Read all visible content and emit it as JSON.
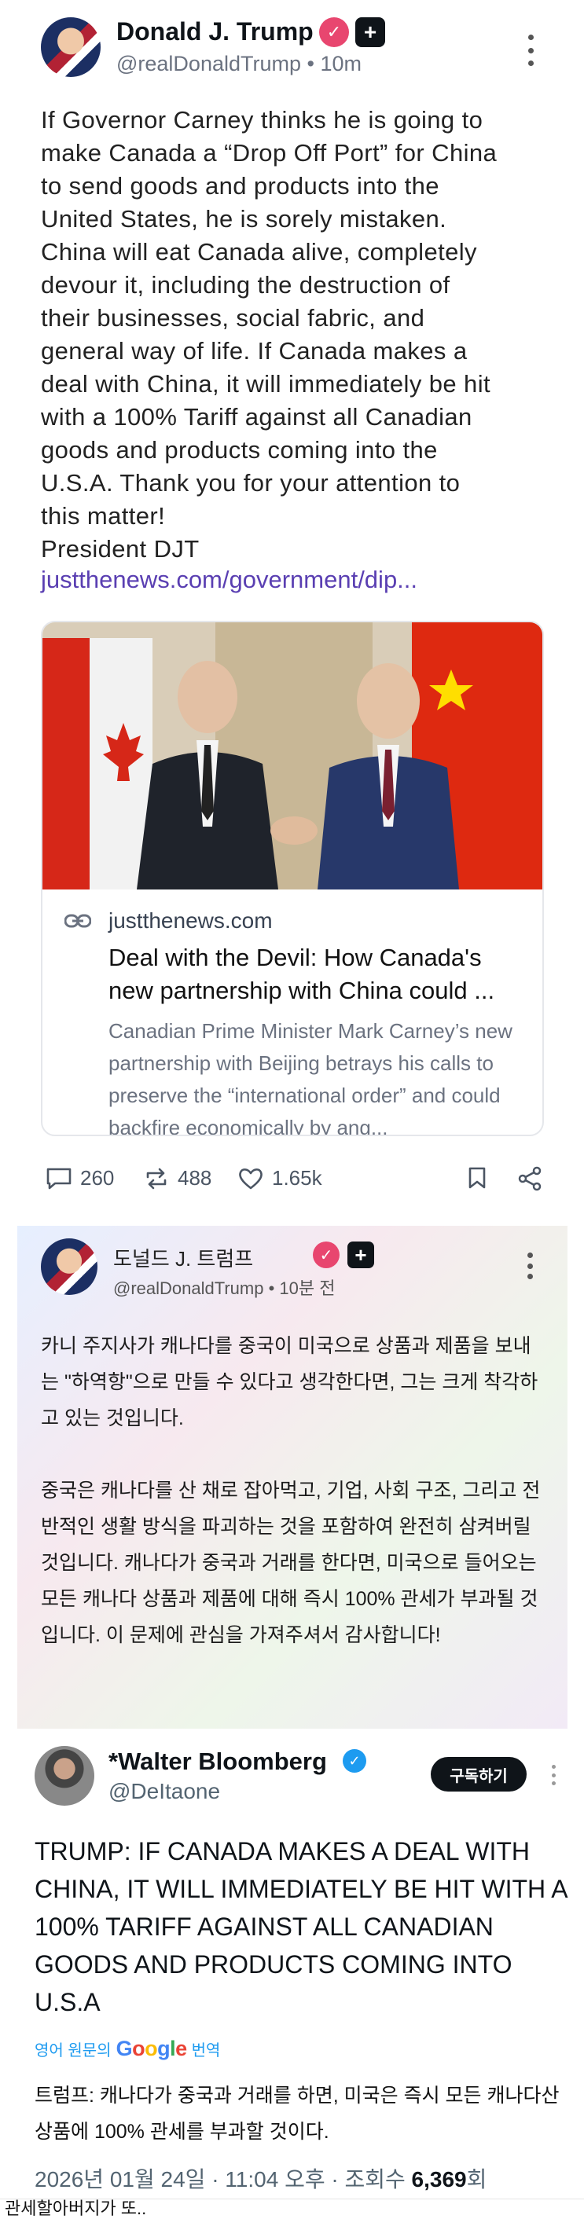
{
  "truth_post": {
    "author_name": "Donald J. Trump",
    "handle_time": "@realDonaldTrump • 10m",
    "body_lines": [
      "If Governor Carney thinks he is going to",
      "make Canada a “Drop Off Port” for China",
      "to send goods and products into the",
      "United States, he is sorely mistaken.",
      "China will eat Canada alive, completely",
      "devour it, including the destruction of",
      "their businesses, social fabric, and",
      "general way of life. If Canada makes a",
      "deal with China, it will immediately be hit",
      "with a 100% Tariff against all Canadian",
      "goods and products coming into the",
      "U.S.A. Thank you for your attention to",
      "this matter!",
      "President DJT"
    ],
    "link_text": "justthenews.com/government/dip...",
    "card": {
      "source": "justthenews.com",
      "title": "Deal with the Devil: How Canada's new partnership with China could ...",
      "description": "Canadian Prime Minister Mark Carney’s new partnership with Beijing betrays his calls to preserve the “international order” and could backfire economically by ang..."
    },
    "actions": {
      "replies": "260",
      "retruths": "488",
      "likes": "1.65k"
    }
  },
  "korean_card": {
    "author_name": "도널드 J. 트럼프",
    "handle_time": "@realDonaldTrump • 10분 전",
    "paragraphs": [
      "카니 주지사가 캐나다를 중국이 미국으로 상품과 제품을 보내는 \"하역항\"으로 만들 수 있다고 생각한다면, 그는 크게 착각하고 있는 것입니다.",
      "중국은 캐나다를 산 채로 잡아먹고, 기업, 사회 구조, 그리고 전반적인 생활 방식을 파괴하는 것을 포함하여 완전히 삼켜버릴 것입니다. 캐나다가 중국과 거래를 한다면, 미국으로 들어오는 모든 캐나다 상품과 제품에 대해 즉시 100% 관세가 부과될 것입니다. 이 문제에 관심을 가져주셔서 감사합니다!"
    ]
  },
  "x_post": {
    "author_name": "*Walter Bloomberg",
    "handle": "@DeItaone",
    "subscribe_label": "구독하기",
    "body": "TRUMP: IF CANADA MAKES A DEAL WITH CHINA, IT WILL IMMEDIATELY BE HIT WITH A 100% TARIFF AGAINST ALL CANADIAN GOODS AND PRODUCTS COMING INTO U.S.A",
    "translate_prefix": "영어 원문의",
    "translate_brand": "Google",
    "translate_suffix": "번역",
    "translated_body": "트럼프: 캐나다가 중국과 거래를 하면, 미국은 즉시 모든 캐나다산 상품에 100% 관세를 부과할 것이다.",
    "date_text": "2026년 01월 24일 · 11:04 오후 · 조회수",
    "views": "6,369",
    "views_suffix": "회"
  },
  "caption": "관세할아버지가 또..",
  "colors": {
    "link_purple": "#5a3fb2",
    "truth_badge": "#e8466f",
    "x_blue": "#1d9bf0"
  }
}
